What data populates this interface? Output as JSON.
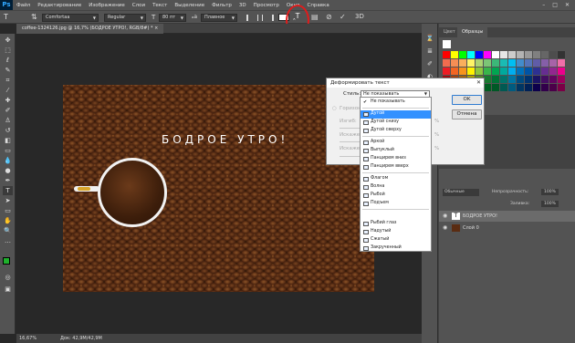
{
  "app": {
    "logo": "Ps"
  },
  "menu": [
    "Файл",
    "Редактирование",
    "Изображение",
    "Слои",
    "Текст",
    "Выделение",
    "Фильтр",
    "3D",
    "Просмотр",
    "Окно",
    "Справка"
  ],
  "window_controls": [
    "–",
    "□",
    "✕"
  ],
  "options": {
    "font_family": "Comfortaa",
    "font_style": "Regular",
    "font_size": "80 пт",
    "aa": "Плавное",
    "warp_icon": "warp-text-icon"
  },
  "document_tab": "coffee-1324126.jpg @ 16,7% (БОДРОЕ УТРО!, RGB/8#) *",
  "canvas": {
    "headline": "БОДРОЕ УТРО!"
  },
  "status": {
    "zoom": "16,67%",
    "doc": "Док: 42,9M/42,9M"
  },
  "swatches_panel": {
    "tabs": [
      "Цвет",
      "Образцы"
    ],
    "colors": [
      "#ff0000",
      "#ffff00",
      "#00ff00",
      "#00ffff",
      "#0000ff",
      "#ff00ff",
      "#ffffff",
      "#e6e6e6",
      "#cccccc",
      "#b3b3b3",
      "#999999",
      "#808080",
      "#666666",
      "#4d4d4d",
      "#333333",
      "#f26c4f",
      "#f68e55",
      "#fbaf5c",
      "#fff467",
      "#acd372",
      "#7cc576",
      "#3bb878",
      "#1abbb4",
      "#00bff3",
      "#438ccb",
      "#5574b9",
      "#605ca8",
      "#855fa8",
      "#a763a8",
      "#f06ea9",
      "#ed1c24",
      "#f26522",
      "#f7941d",
      "#fff200",
      "#8dc63f",
      "#39b54a",
      "#00a651",
      "#00a99d",
      "#00aeef",
      "#0072bc",
      "#0054a6",
      "#2e3192",
      "#662d91",
      "#92278f",
      "#ec008c",
      "#9e0b0f",
      "#a0410d",
      "#a36209",
      "#aba000",
      "#598527",
      "#197b30",
      "#007236",
      "#00746b",
      "#0076a3",
      "#004b80",
      "#003471",
      "#1b1464",
      "#440e62",
      "#630460",
      "#9e005d",
      "#790000",
      "#7b2e00",
      "#7d4900",
      "#827b00",
      "#406618",
      "#005e20",
      "#005826",
      "#005952",
      "#005b7f",
      "#003663",
      "#002157",
      "#0d004c",
      "#32004b",
      "#4b0049",
      "#7b0046"
    ]
  },
  "layers_panel": {
    "opacity_label": "Непрозрачность:",
    "opacity": "100%",
    "fill_label": "Заливка:",
    "fill": "100%",
    "blend": "Обычные",
    "layers": [
      {
        "name": "БОДРОЕ УТРО!",
        "type": "T"
      },
      {
        "name": "Слой 0",
        "type": "img"
      }
    ]
  },
  "dialog": {
    "title": "Деформировать текст",
    "style_label": "Стиль:",
    "style_value": "Не показывать",
    "ok": "OK",
    "cancel": "Отмена",
    "horizontal": "Горизонтальная",
    "bend": "Изгиб:",
    "hdist": "Искажение по горизонтали:",
    "vdist": "Искажение по вертикали:",
    "pct": "%"
  },
  "dropdown": {
    "groups": [
      [
        "Не показывать"
      ],
      [
        "Дугой",
        "Дугой снизу",
        "Дугой сверху"
      ],
      [
        "Аркой",
        "Выпуклый",
        "Панцирем вниз",
        "Панцирем вверх"
      ],
      [
        "Флагом",
        "Волна",
        "Рыбой",
        "Подъем"
      ],
      [
        "Рыбий глаз",
        "Надутый",
        "Сжатый",
        "Закрученный"
      ]
    ],
    "selected": "Дугой",
    "checked": "Не показывать"
  }
}
